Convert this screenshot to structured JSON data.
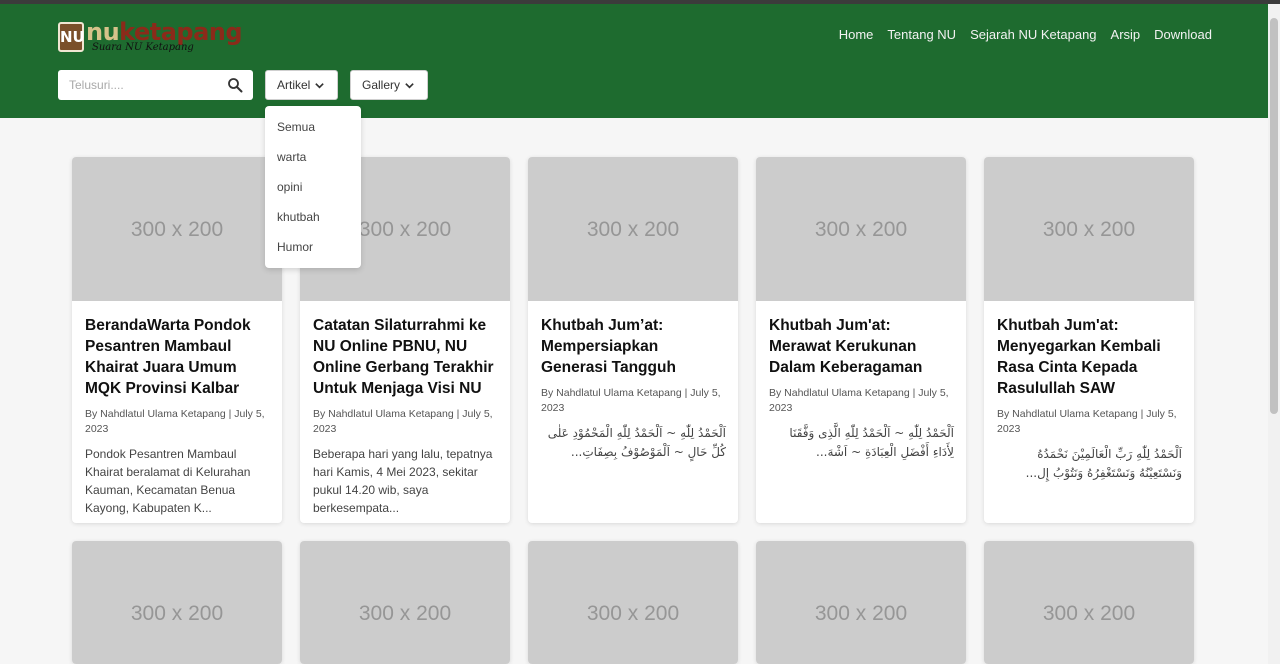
{
  "logo": {
    "mark": "NU",
    "word_prefix": "nu",
    "word": "ketapang",
    "tagline": "Suara NU Ketapang"
  },
  "nav": [
    {
      "label": "Home"
    },
    {
      "label": "Tentang NU"
    },
    {
      "label": "Sejarah NU Ketapang"
    },
    {
      "label": "Arsip"
    },
    {
      "label": "Download"
    }
  ],
  "search": {
    "placeholder": "Telusuri....",
    "icon": "search-icon"
  },
  "filters": {
    "artikel_label": "Artikel",
    "gallery_label": "Gallery"
  },
  "artikel_menu": [
    "Semua",
    "warta",
    "opini",
    "khutbah",
    "Humor"
  ],
  "placeholder_text": "300 x 200",
  "cards": [
    {
      "title": "BerandaWarta Pondok Pesantren Mambaul Khairat Juara Umum MQK Provinsi Kalbar",
      "meta": "By Nahdlatul Ulama Ketapang | July 5, 2023",
      "excerpt": "Pondok Pesantren Mambaul Khairat beralamat di Kelurahan Kauman, Kecamatan Benua Kayong, Kabupaten K..."
    },
    {
      "title": "Catatan Silaturrahmi ke NU Online PBNU, NU Online Gerbang Terakhir Untuk Menjaga Visi NU",
      "meta": "By Nahdlatul Ulama Ketapang | July 5, 2023",
      "excerpt": "Beberapa hari yang lalu, tepatnya hari Kamis, 4 Mei 2023, sekitar pukul 14.20 wib, saya berkesempata..."
    },
    {
      "title": "Khutbah Jum’at: Mempersiapkan Generasi Tangguh",
      "meta": "By Nahdlatul Ulama Ketapang | July 5, 2023",
      "excerpt": "اَلْحَمْدُ لِلّٰهِ ~ اَلْحَمْدُ لِلّٰهِ الْمَحْمُوْدِ عَلٰى كُلِّ حَالٍ ~ اَلْمَوْصُوْفُ بِصِفَاتِ..."
    },
    {
      "title": "Khutbah Jum'at: Merawat Kerukunan Dalam Keberagaman",
      "meta": "By Nahdlatul Ulama Ketapang | July 5, 2023",
      "excerpt": "اَلْحَمْدُ لِلّٰهِ ~ اَلْحَمْدُ لِلّٰهِ الَّذِى وَفَّقَنَا لِأَدَاءِ أَفْضَلِ الْعِبَادَةِ ~ اَشْهَ..."
    },
    {
      "title": "Khutbah Jum'at: Menyegarkan Kembali Rasa Cinta Kepada Rasulullah SAW",
      "meta": "By Nahdlatul Ulama Ketapang | July 5, 2023",
      "excerpt": "اَلْحَمْدُ لِلّٰهِ رَبِّ الْعَالَمِيْنَ نَحْمَدُهُ وَنَسْتَعِيْنُهُ وَنَسْتَغْفِرُهُ وَنَتُوْبُ إِل..."
    }
  ],
  "colors": {
    "header_bg": "#1e6b2f",
    "placeholder_bg": "#cccccc",
    "page_bg": "#f6f6f6"
  }
}
